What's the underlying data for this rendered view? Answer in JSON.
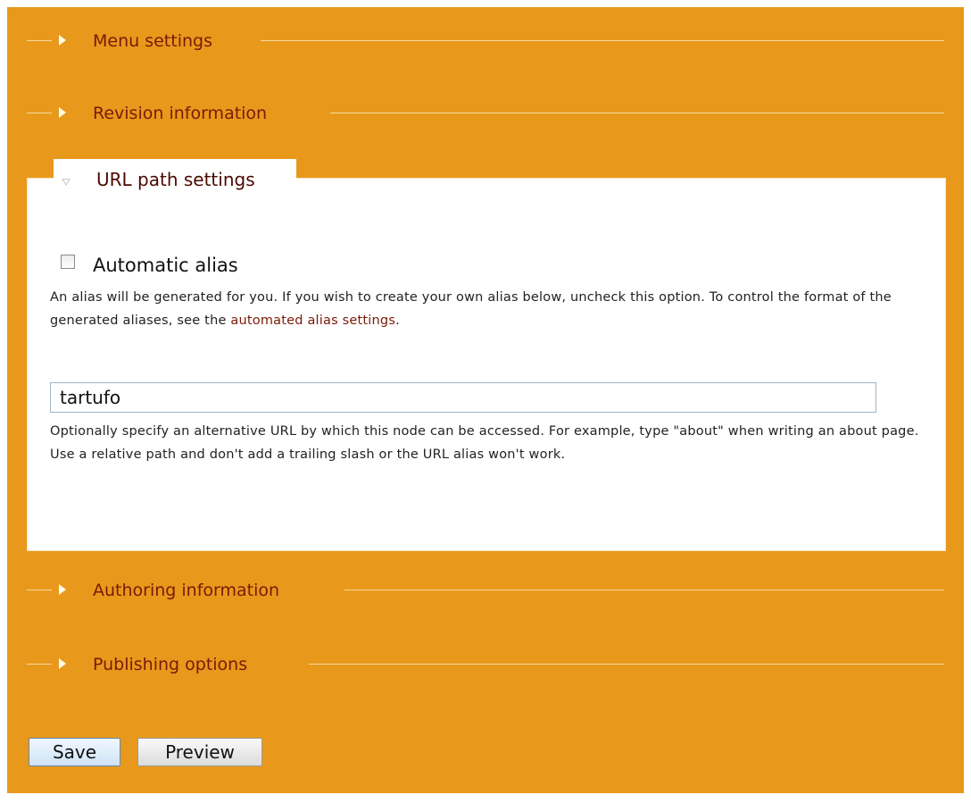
{
  "fieldsets": {
    "menu": {
      "label": "Menu settings"
    },
    "revision": {
      "label": "Revision information"
    },
    "url_path": {
      "label": "URL path settings",
      "automatic_alias_label": "Automatic alias",
      "automatic_alias_checked": false,
      "alias_description_pre": "An alias will be generated for you. If you wish to create your own alias below, uncheck this option. To control the format of the generated aliases, see the",
      "alias_description_link": "automated alias settings",
      "alias_description_post": ".",
      "path_value": "tartufo",
      "path_description": "Optionally specify an alternative URL by which this node can be accessed. For example, type \"about\" when writing an about page. Use a relative path and don't add a trailing slash or the URL alias won't work."
    },
    "authoring": {
      "label": "Authoring information"
    },
    "publishing": {
      "label": "Publishing options"
    }
  },
  "buttons": {
    "save_label": "Save",
    "preview_label": "Preview"
  },
  "colors": {
    "background": "#e8991c",
    "legend_link": "#7a1a08",
    "fieldset_body": "#ffffff"
  }
}
